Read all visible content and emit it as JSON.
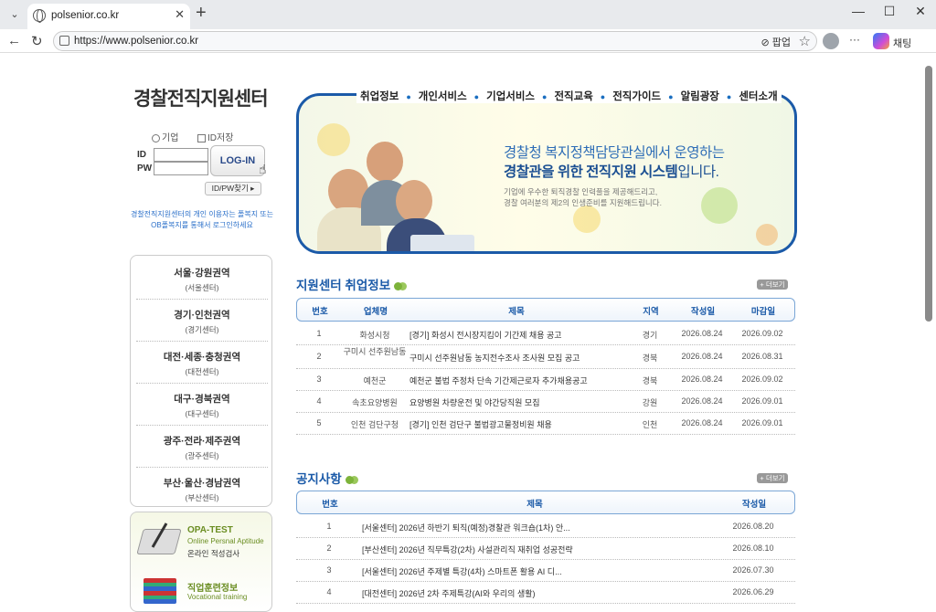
{
  "browser": {
    "tab_title": "polsenior.co.kr",
    "url": "https://www.polsenior.co.kr",
    "popup_label": "팝업",
    "chat_label": "채팅"
  },
  "sidebar": {
    "site_title": "경찰전직지원센터",
    "radio_company": "기업",
    "checkbox_save_id": "ID저장",
    "id_label": "ID",
    "pw_label": "PW",
    "login_button": "LOG-IN",
    "find_button": "ID/PW찾기",
    "notice": "경찰전직지원센터의 개인 이용자는 폴복지 또는 OB폴복지를 통해서 로그인하세요",
    "regions": [
      {
        "name": "서울·강원권역",
        "sub": "(서울센터)"
      },
      {
        "name": "경기·인천권역",
        "sub": "(경기센터)"
      },
      {
        "name": "대전·세종·충청권역",
        "sub": "(대전센터)"
      },
      {
        "name": "대구·경북권역",
        "sub": "(대구센터)"
      },
      {
        "name": "광주·전라·제주권역",
        "sub": "(광주센터)"
      },
      {
        "name": "부산·울산·경남권역",
        "sub": "(부산센터)"
      }
    ],
    "opa_title": "OPA-TEST",
    "opa_sub": "Online Persnal Aptitude",
    "opa_kr": "온라인 적성검사",
    "voc_title": "직업훈련정보",
    "voc_sub": "Vocational training"
  },
  "gnb": [
    "취업정보",
    "개인서비스",
    "기업서비스",
    "전직교육",
    "전직가이드",
    "알림광장",
    "센터소개"
  ],
  "hero": {
    "line1": "경찰청 복지정책담당관실에서 운영하는",
    "line2_bold": "경찰관을 위한 전직지원 시스템",
    "line2_rest": "입니다.",
    "desc1": "기업에 우수한 퇴직경찰 인력풀을 제공해드리고,",
    "desc2": "경찰 여러분의 제2의 인생준비를 지원해드립니다."
  },
  "jobs": {
    "title": "지원센터 취업정보",
    "more": "+ 더보기",
    "headers": [
      "번호",
      "업체명",
      "제목",
      "지역",
      "작성일",
      "마감일"
    ],
    "rows": [
      [
        "1",
        "화성시청",
        "[경기] 화성시 전시장지킴이 기간제 채용 공고",
        "경기",
        "2026.08.24",
        "2026.09.02"
      ],
      [
        "2",
        "구미시 선주원남동",
        "구미시 선주원남동 농지전수조사 조사원 모집 공고",
        "경북",
        "2026.08.24",
        "2026.08.31"
      ],
      [
        "3",
        "예천군",
        "예천군 불법 주정차 단속 기간제근로자 추가채용공고",
        "경북",
        "2026.08.24",
        "2026.09.02"
      ],
      [
        "4",
        "속초요양병원",
        "요양병원 차량운전 및 야간당직원 모집",
        "강원",
        "2026.08.24",
        "2026.09.01"
      ],
      [
        "5",
        "인천 검단구청",
        "[경기] 인천 검단구 불법광고물정비원 채용",
        "인천",
        "2026.08.24",
        "2026.09.01"
      ]
    ]
  },
  "notices": {
    "title": "공지사항",
    "more": "+ 더보기",
    "headers": [
      "번호",
      "제목",
      "작성일"
    ],
    "rows": [
      [
        "1",
        "[서울센터] 2026년 하반기 퇴직(예정)경찰관 워크숍(1차) 안...",
        "2026.08.20"
      ],
      [
        "2",
        "[부산센터] 2026년 직무특강(2차) 사설관리직 재취업 성공전략",
        "2026.08.10"
      ],
      [
        "3",
        "[서울센터] 2026년 주제별 특강(4차) 스마트폰 활용 AI 디...",
        "2026.07.30"
      ],
      [
        "4",
        "[대전센터] 2026년 2차 주제특강(AI와 우리의 생활)",
        "2026.06.29"
      ]
    ]
  }
}
